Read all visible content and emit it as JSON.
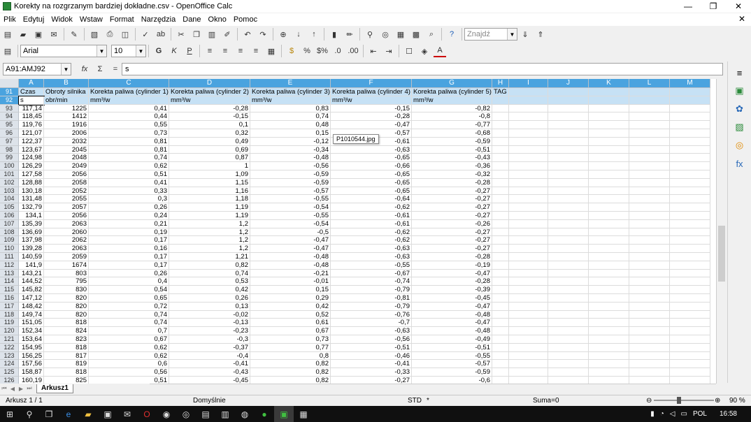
{
  "window": {
    "title": "Korekty na rozgrzanym bardziej dokładne.csv - OpenOffice Calc",
    "minimize": "—",
    "restore": "❐",
    "close": "✕"
  },
  "menu": [
    "Plik",
    "Edytuj",
    "Widok",
    "Wstaw",
    "Format",
    "Narzędzia",
    "Dane",
    "Okno",
    "Pomoc"
  ],
  "menu_close": "✕",
  "find": {
    "placeholder": "Znajdź"
  },
  "font": {
    "name": "Arial",
    "size": "10"
  },
  "formula": {
    "namebox": "A91:AMJ92",
    "content": "s"
  },
  "columns": [
    "A",
    "B",
    "C",
    "D",
    "E",
    "F",
    "G",
    "H",
    "I",
    "J",
    "K",
    "L",
    "M"
  ],
  "header_rows": [
    {
      "row": "91",
      "cells": [
        "Czas",
        "Obroty silnika",
        "Korekta paliwa (cylinder 1)",
        "Korekta paliwa (cylinder 2)",
        "Korekta paliwa (cylinder 3)",
        "Korekta paliwa (cylinder 4)",
        "Korekta paliwa (cylinder 5)",
        "TAG"
      ]
    },
    {
      "row": "92",
      "cells": [
        "s",
        "obr/min",
        "mm³/w",
        "mm³/w",
        "mm³/w",
        "mm³/w",
        "mm³/w",
        ""
      ]
    }
  ],
  "rows": [
    [
      "93",
      "117,14",
      "1225",
      "0,41",
      "-0,28",
      "0,83",
      "-0,15",
      "-0,82"
    ],
    [
      "94",
      "118,45",
      "1412",
      "0,44",
      "-0,15",
      "0,74",
      "-0,28",
      "-0,8"
    ],
    [
      "95",
      "119,76",
      "1916",
      "0,55",
      "0,1",
      "0,48",
      "-0,47",
      "-0,77"
    ],
    [
      "96",
      "121,07",
      "2006",
      "0,73",
      "0,32",
      "0,15",
      "-0,57",
      "-0,68"
    ],
    [
      "97",
      "122,37",
      "2032",
      "0,81",
      "0,49",
      "-0,12",
      "-0,61",
      "-0,59"
    ],
    [
      "98",
      "123,67",
      "2045",
      "0,81",
      "0,69",
      "-0,34",
      "-0,63",
      "-0,51"
    ],
    [
      "99",
      "124,98",
      "2048",
      "0,74",
      "0,87",
      "-0,48",
      "-0,65",
      "-0,43"
    ],
    [
      "100",
      "126,29",
      "2049",
      "0,62",
      "1",
      "-0,56",
      "-0,66",
      "-0,36"
    ],
    [
      "101",
      "127,58",
      "2056",
      "0,51",
      "1,09",
      "-0,59",
      "-0,65",
      "-0,32"
    ],
    [
      "102",
      "128,88",
      "2058",
      "0,41",
      "1,15",
      "-0,59",
      "-0,65",
      "-0,28"
    ],
    [
      "103",
      "130,18",
      "2052",
      "0,33",
      "1,16",
      "-0,57",
      "-0,65",
      "-0,27"
    ],
    [
      "104",
      "131,48",
      "2055",
      "0,3",
      "1,18",
      "-0,55",
      "-0,64",
      "-0,27"
    ],
    [
      "105",
      "132,79",
      "2057",
      "0,26",
      "1,19",
      "-0,54",
      "-0,62",
      "-0,27"
    ],
    [
      "106",
      "134,1",
      "2056",
      "0,24",
      "1,19",
      "-0,55",
      "-0,61",
      "-0,27"
    ],
    [
      "107",
      "135,39",
      "2063",
      "0,21",
      "1,2",
      "-0,54",
      "-0,61",
      "-0,26"
    ],
    [
      "108",
      "136,69",
      "2060",
      "0,19",
      "1,2",
      "-0,5",
      "-0,62",
      "-0,27"
    ],
    [
      "109",
      "137,98",
      "2062",
      "0,17",
      "1,2",
      "-0,47",
      "-0,62",
      "-0,27"
    ],
    [
      "110",
      "139,28",
      "2063",
      "0,16",
      "1,2",
      "-0,47",
      "-0,63",
      "-0,27"
    ],
    [
      "111",
      "140,59",
      "2059",
      "0,17",
      "1,21",
      "-0,48",
      "-0,63",
      "-0,28"
    ],
    [
      "112",
      "141,9",
      "1674",
      "0,17",
      "0,82",
      "-0,48",
      "-0,55",
      "-0,19"
    ],
    [
      "113",
      "143,21",
      "803",
      "0,26",
      "0,74",
      "-0,21",
      "-0,67",
      "-0,47"
    ],
    [
      "114",
      "144,52",
      "795",
      "0,4",
      "0,53",
      "-0,01",
      "-0,74",
      "-0,28"
    ],
    [
      "115",
      "145,82",
      "830",
      "0,54",
      "0,42",
      "0,15",
      "-0,79",
      "-0,39"
    ],
    [
      "116",
      "147,12",
      "820",
      "0,65",
      "0,26",
      "0,29",
      "-0,81",
      "-0,45"
    ],
    [
      "117",
      "148,42",
      "820",
      "0,72",
      "0,13",
      "0,42",
      "-0,79",
      "-0,47"
    ],
    [
      "118",
      "149,74",
      "820",
      "0,74",
      "-0,02",
      "0,52",
      "-0,76",
      "-0,48"
    ],
    [
      "119",
      "151,05",
      "818",
      "0,74",
      "-0,13",
      "0,61",
      "-0,7",
      "-0,47"
    ],
    [
      "120",
      "152,34",
      "824",
      "0,7",
      "-0,23",
      "0,67",
      "-0,63",
      "-0,48"
    ],
    [
      "121",
      "153,64",
      "823",
      "0,67",
      "-0,3",
      "0,73",
      "-0,56",
      "-0,49"
    ],
    [
      "122",
      "154,95",
      "818",
      "0,62",
      "-0,37",
      "0,77",
      "-0,51",
      "-0,51"
    ],
    [
      "123",
      "156,25",
      "817",
      "0,62",
      "-0,4",
      "0,8",
      "-0,46",
      "-0,55"
    ],
    [
      "124",
      "157,56",
      "819",
      "0,6",
      "-0,41",
      "0,82",
      "-0,41",
      "-0,57"
    ],
    [
      "125",
      "158,87",
      "818",
      "0,56",
      "-0,43",
      "0,82",
      "-0,33",
      "-0,59"
    ],
    [
      "126",
      "160,19",
      "825",
      "0,51",
      "-0,45",
      "0,82",
      "-0,27",
      "-0,6"
    ]
  ],
  "tooltip": "P1010544.jpg",
  "sheet_tab": "Arkusz1",
  "status": {
    "sheet": "Arkusz 1 / 1",
    "style": "Domyślnie",
    "mode": "STD",
    "modified": "*",
    "sum": "Suma=0",
    "zoom": "90 %"
  },
  "tray": {
    "lang": "POL",
    "time": "16:58"
  },
  "colors": {
    "selected_header": "#4aa3df",
    "selection": "#c6e1f5"
  }
}
